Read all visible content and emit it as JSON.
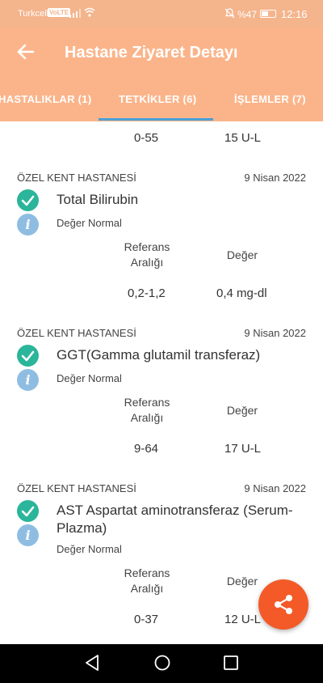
{
  "status_bar": {
    "carrier": "Turkcell",
    "volte": "VoLTE",
    "battery": "%47",
    "time": "12:16"
  },
  "app_bar": {
    "title": "Hastane Ziyaret Detayı"
  },
  "tabs": [
    {
      "label": "HASTALIKLAR (1)"
    },
    {
      "label": "TETKİKLER (6)"
    },
    {
      "label": "İŞLEMLER (7)"
    }
  ],
  "top_partial": {
    "range": "0-55",
    "value": "15 U-L"
  },
  "column_headers": {
    "reference": "Referans Aralığı",
    "value": "Değer"
  },
  "tests": [
    {
      "hospital": "ÖZEL KENT HASTANESİ",
      "date": "9 Nisan 2022",
      "name": "Total Bilirubin",
      "status": "Değer Normal",
      "reference_range": "0,2-1,2",
      "value": "0,4 mg-dl"
    },
    {
      "hospital": "ÖZEL KENT HASTANESİ",
      "date": "9 Nisan 2022",
      "name": "GGT(Gamma glutamil transferaz)",
      "status": "Değer Normal",
      "reference_range": "9-64",
      "value": "17 U-L"
    },
    {
      "hospital": "ÖZEL KENT HASTANESİ",
      "date": "9 Nisan 2022",
      "name": "AST Aspartat aminotransferaz (Serum-Plazma)",
      "status": "Değer Normal",
      "reference_range": "0-37",
      "value": "12 U-L"
    }
  ],
  "icons": {
    "back": "arrow-left-icon",
    "check": "check-circle-icon",
    "info": "info-icon",
    "share": "share-icon"
  },
  "colors": {
    "accent": "#fbb48a",
    "tab_indicator": "#4aa0d6",
    "check": "#2bb59a",
    "info": "#8fbde2",
    "fab": "#f35a28"
  }
}
